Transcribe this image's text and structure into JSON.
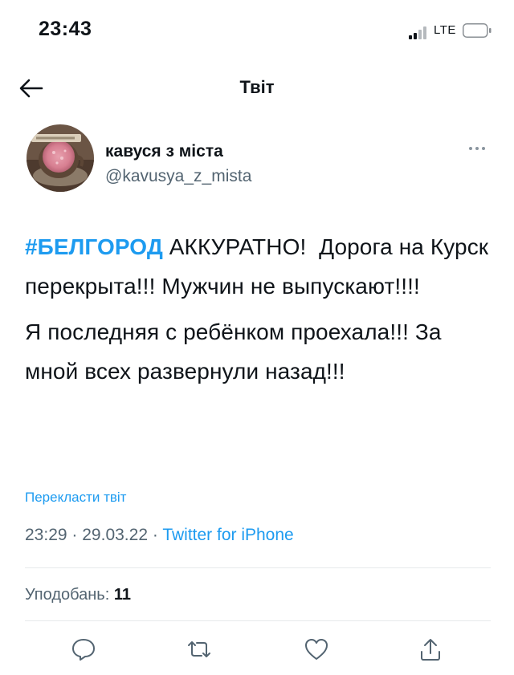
{
  "status_bar": {
    "time": "23:43",
    "network": "LTE"
  },
  "nav": {
    "title": "Твіт",
    "back_icon": "arrow-left-icon"
  },
  "author": {
    "name": "кавуся з міста",
    "handle": "@kavusya_z_mista",
    "avatar_icon": "coffee-cup-avatar"
  },
  "tweet": {
    "hashtag": "#БЕЛГОРОД",
    "paragraph1_rest": " АККУРАТНО!  Дорога на Курск перекрыта!!! Мужчин не выпускают!!!!",
    "paragraph2": "Я последняя с ребёнком проехала!!! За мной всех развернули назад!!!"
  },
  "translate_label": "Перекласти твіт",
  "meta": {
    "time": "23:29",
    "separator": "·",
    "date": "29.03.22",
    "source": "Twitter for iPhone"
  },
  "likes": {
    "label": "Уподобань: ",
    "count": "11"
  },
  "colors": {
    "accent": "#1d9bf0",
    "text": "#0f1419",
    "secondary": "#536471"
  },
  "actions": [
    "reply-icon",
    "retweet-icon",
    "like-icon",
    "share-icon"
  ]
}
